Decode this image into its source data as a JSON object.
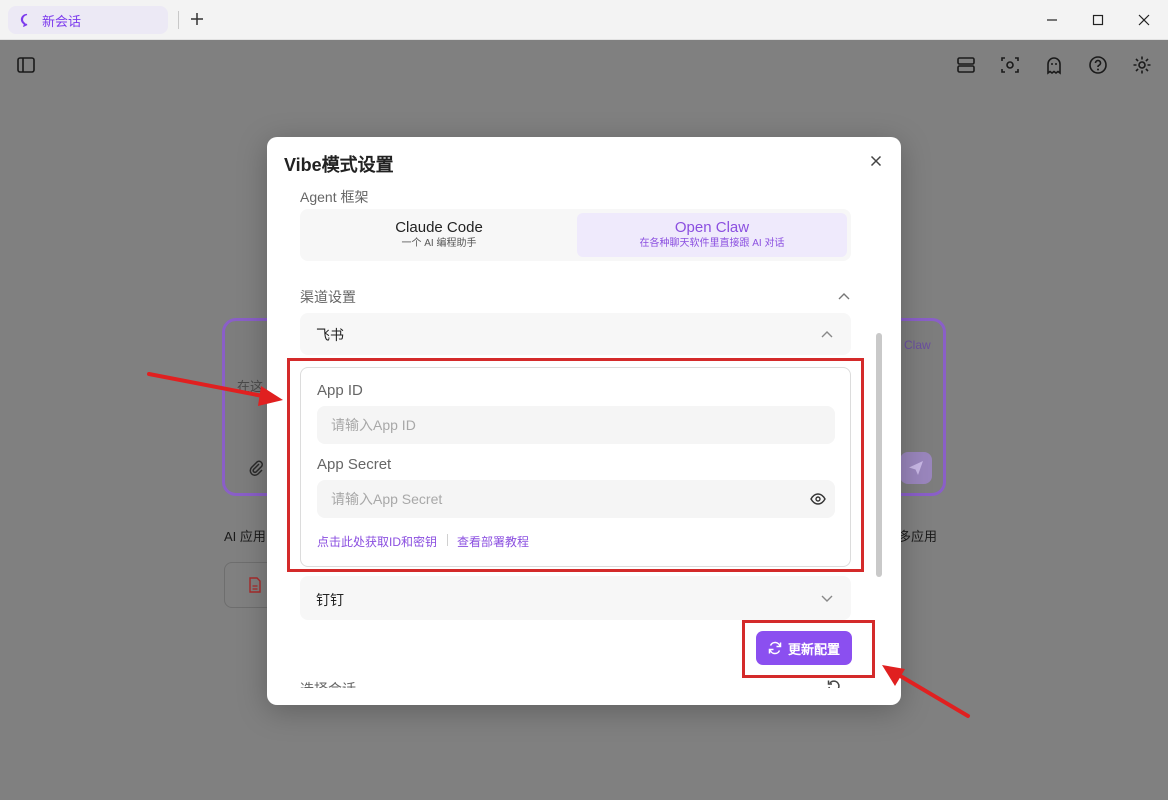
{
  "tab": {
    "title": "新会话",
    "chat_icon": "chat-bubble-icon",
    "new_tab_icon": "plus-icon"
  },
  "window_controls": [
    "minimize-icon",
    "maximize-icon",
    "close-icon"
  ],
  "toolbar_icons": [
    "sidebar-toggle-icon",
    "server-icon",
    "scan-icon",
    "ghost-icon",
    "help-icon",
    "settings-icon"
  ],
  "background": {
    "input_hint": "在这",
    "app_label_left": "AI 应用",
    "app_label_right": "多应用",
    "claw_label": "Claw"
  },
  "modal": {
    "title": "Vibe模式设置",
    "agent_framework_label": "Agent 框架",
    "options": [
      {
        "title": "Claude Code",
        "subtitle": "一个 AI 编程助手",
        "active": false
      },
      {
        "title": "Open Claw",
        "subtitle": "在各种聊天软件里直接跟 AI 对话",
        "active": true
      }
    ],
    "channel_settings_label": "渠道设置",
    "feishu": {
      "title": "飞书",
      "app_id_label": "App ID",
      "app_id_placeholder": "请输入App ID",
      "app_secret_label": "App Secret",
      "app_secret_placeholder": "请输入App Secret",
      "link_get_id": "点击此处获取ID和密钥",
      "link_tutorial": "查看部署教程"
    },
    "dingtalk": {
      "title": "钉钉"
    },
    "update_button": "更新配置",
    "partial_section_label": "选择会话"
  },
  "colors": {
    "accent": "#8b4ff0",
    "annotation_red": "#d42a2a",
    "overlay": "#808080"
  }
}
